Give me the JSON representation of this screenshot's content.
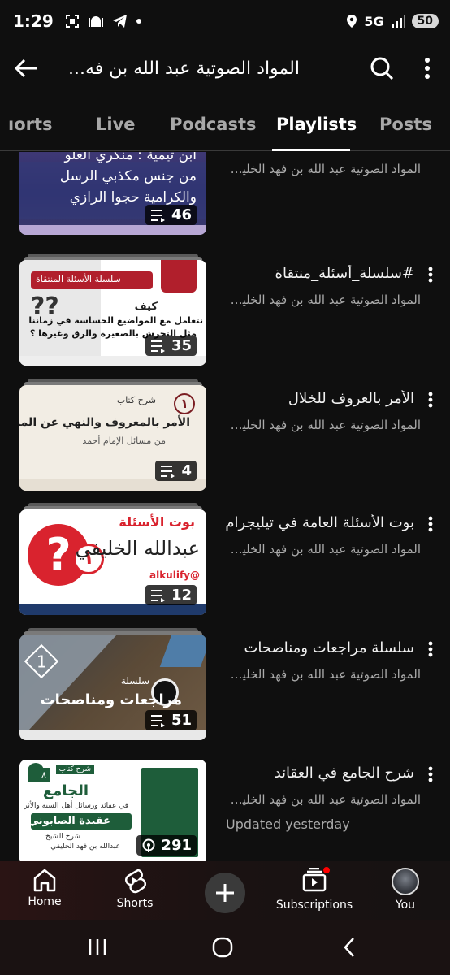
{
  "status": {
    "time": "1:29",
    "network": "5G",
    "battery": "50"
  },
  "app_bar": {
    "title": "المواد الصوتية عبد الله بن فه..."
  },
  "tabs": [
    {
      "label": "Shorts",
      "visible_label": "ıorts"
    },
    {
      "label": "Live"
    },
    {
      "label": "Podcasts"
    },
    {
      "label": "Playlists"
    },
    {
      "label": "Posts"
    }
  ],
  "playlists": [
    {
      "title": "",
      "channel": "المواد الصوتية عبد الله بن فهد الخليف...",
      "count": "46",
      "thumb_lines": [
        "ابن تيمية : منكري العلو",
        "من جنس مكذبي الرسل",
        "والكرامية حجوا الرازي"
      ]
    },
    {
      "title": "#سلسلة_أسئلة_منتقاة",
      "channel": "المواد الصوتية عبد الله بن فهد الخليف...",
      "count": "35",
      "thumb_lines": [
        "سلسلة الأسئلة المنتقاة",
        "كيف",
        "نتعامل مع المواضيع الحساسة في زماننا",
        "مثل التحرش بالصغيرة والرق وغيرها ؟"
      ]
    },
    {
      "title": "الأمر بالعروف للخلال",
      "channel": "المواد الصوتية عبد الله بن فهد الخليف...",
      "count": "4",
      "thumb_lines": [
        "شرح كتاب",
        "الأمر بالمعروف والنهي عن المنكر",
        "من مسائل الإمام أحمد"
      ]
    },
    {
      "title": "بوت الأسئلة العامة في تيليجرام",
      "channel": "المواد الصوتية عبد الله بن فهد الخليف...",
      "count": "12",
      "thumb_lines": [
        "بوت الأسئلة",
        "عبدالله الخليفي",
        "@alkulify"
      ]
    },
    {
      "title": "سلسلة مراجعات ومناصحات",
      "channel": "المواد الصوتية عبد الله بن فهد الخليف...",
      "count": "51",
      "thumb_lines": [
        "سلسلة",
        "مراجعات ومناصحات"
      ]
    },
    {
      "title": "شرح الجامع في العقائد",
      "channel": "المواد الصوتية عبد الله بن فهد الخليف...",
      "count": "291",
      "extra": "Updated yesterday",
      "thumb_lines": [
        "شرح كتاب",
        "الجامع",
        "في عقائد ورسائل أهل السنة والأثر",
        "عقيدة الصابوني",
        "شرح الشيخ",
        "عبدالله بن فهد الخليفي"
      ]
    }
  ],
  "bottom_nav": {
    "home": "Home",
    "shorts": "Shorts",
    "subscriptions": "Subscriptions",
    "you": "You"
  },
  "colors": {
    "background": "#0f0f0f",
    "text_primary": "#f1f1f1",
    "text_secondary": "#aaaaaa",
    "notification_dot": "#ff0000"
  }
}
